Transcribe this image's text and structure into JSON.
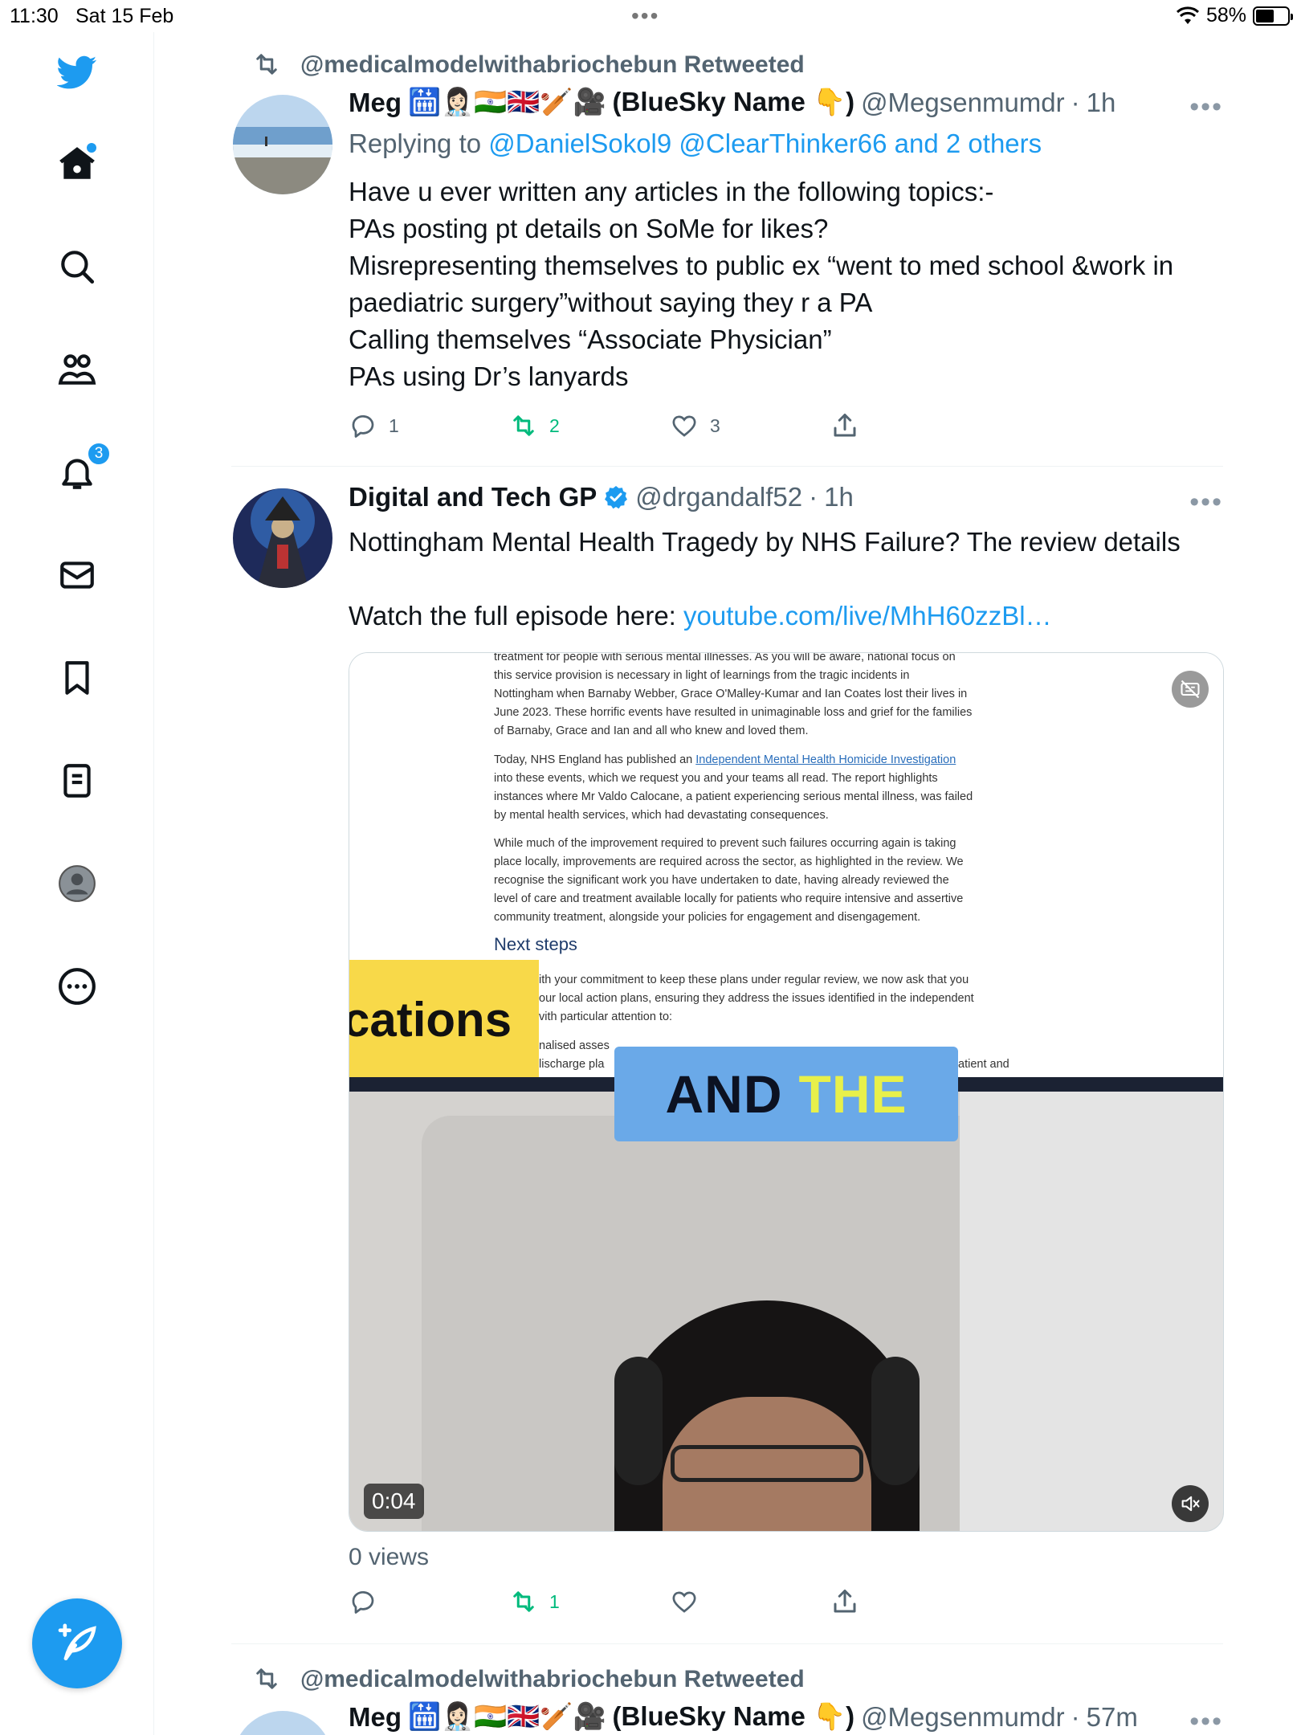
{
  "status_bar": {
    "time": "11:30",
    "date": "Sat 15 Feb",
    "battery": "58%",
    "battery_level": 0.58
  },
  "sidebar": {
    "items": [
      {
        "name": "twitter-logo",
        "icon": "bird-icon"
      },
      {
        "name": "home",
        "icon": "home-icon",
        "has_dot": true
      },
      {
        "name": "explore",
        "icon": "search-icon"
      },
      {
        "name": "communities",
        "icon": "people-icon"
      },
      {
        "name": "notifications",
        "icon": "bell-icon",
        "badge": "3"
      },
      {
        "name": "messages",
        "icon": "mail-icon"
      },
      {
        "name": "bookmarks",
        "icon": "bookmark-icon"
      },
      {
        "name": "lists",
        "icon": "list-icon"
      },
      {
        "name": "profile",
        "icon": "avatar-icon"
      },
      {
        "name": "more",
        "icon": "more-circle-icon"
      }
    ],
    "accent_color": "#1d9bf0"
  },
  "tweets": [
    {
      "retweeted_by": "@medicalmodelwithabriochebun Retweeted",
      "name": "Meg",
      "emojis": "🛗👩🏻‍⚕️🇮🇳🇬🇧🏏🎥",
      "name_suffix": "(BlueSky Name 👇)",
      "handle": "@Megsenmumdr",
      "sep": "·",
      "time": "1h",
      "reply_prefix": "Replying to",
      "reply_to": "@DanielSokol9 @ClearThinker66 and 2 others",
      "lines": [
        "Have u ever written any articles in the following topics:-",
        "PAs posting pt details on SoMe for likes?",
        "Misrepresenting themselves to public ex “went to med school &work in",
        "paediatric surgery”without saying they r a PA",
        "Calling themselves “Associate Physician”",
        "PAs using Dr’s lanyards"
      ],
      "replies": "1",
      "retweets": "2",
      "likes": "3"
    },
    {
      "name": "Digital and Tech GP",
      "handle": "@drgandalf52",
      "sep": "·",
      "time": "1h",
      "line1": "Nottingham Mental Health Tragedy by NHS Failure? The review details",
      "line2_prefix": "Watch the full episode here: ",
      "link": "youtube.com/live/MhH60zzBl…",
      "video": {
        "doc_lines": [
          "treatment for people with serious mental illnesses. As you will be aware, national focus on",
          "this service provision is necessary in light of learnings from the tragic incidents in",
          "Nottingham when Barnaby Webber, Grace O'Malley-Kumar and Ian Coates lost their lives in",
          "June 2023. These horrific events have resulted in unimaginable loss and grief for the families",
          "of Barnaby, Grace and Ian and all who knew and loved them."
        ],
        "doc_para2_prefix": "Today, NHS England has published an ",
        "doc_para2_link": "Independent Mental Health Homicide Investigation",
        "doc_para2": [
          "into these events, which we request you and your teams all read. The report highlights",
          "instances where Mr Valdo Calocane, a patient experiencing serious mental illness, was failed",
          "by mental health services, which had devastating consequences."
        ],
        "doc_para3": [
          "While much of the improvement required to prevent such failures occurring again is taking",
          "place locally, improvements are required across the sector, as highlighted in the review. We",
          "recognise the significant work you have undertaken to date, having already reviewed the",
          "level of care and treatment available locally for patients who require intensive and assertive",
          "community treatment, alongside your policies for engagement and disengagement."
        ],
        "doc_heading": "Next steps",
        "doc_para4": [
          "ith your commitment to keep these plans under regular review, we now ask that you",
          "our local action plans, ensuring they address the issues identified in the independent",
          "vith particular attention to:"
        ],
        "doc_para5": [
          "nalised asses",
          "lischarge pla"
        ],
        "doc_para5_tail": "atient and",
        "banner_text": "cations",
        "caption_word1": "AND",
        "caption_word2": "THE",
        "timer": "0:04"
      },
      "views": "0 views",
      "retweets": "1"
    },
    {
      "retweeted_by": "@medicalmodelwithabriochebun Retweeted",
      "name": "Meg",
      "emojis": "🛗👩🏻‍⚕️🇮🇳🇬🇧🏏🎥",
      "name_suffix": "(BlueSky Name 👇)",
      "handle": "@Megsenmumdr",
      "sep": "·",
      "time": "57m"
    }
  ]
}
